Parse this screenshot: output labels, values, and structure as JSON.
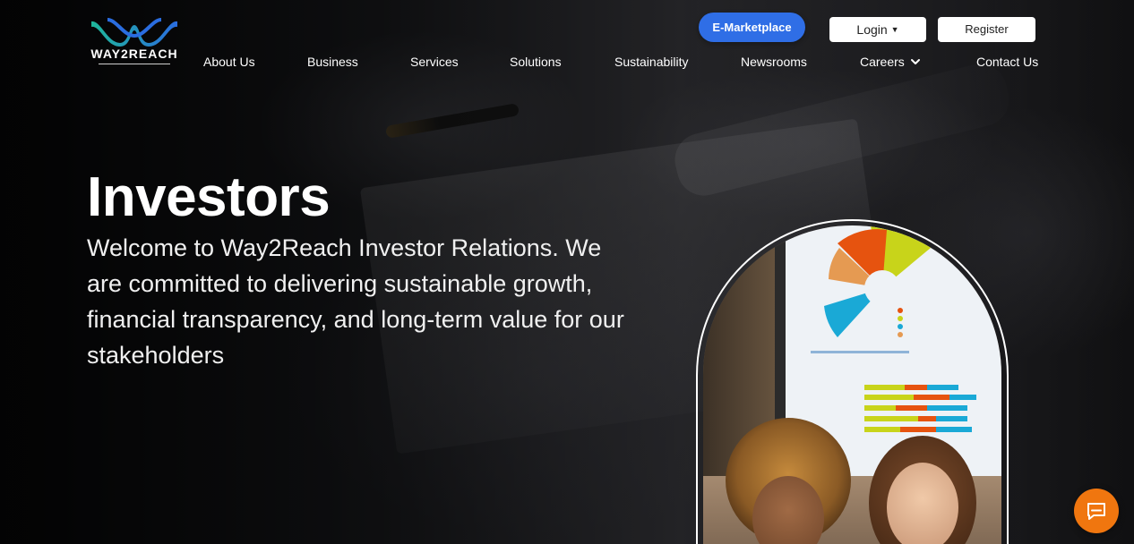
{
  "brand": {
    "logo_text": "way2reach"
  },
  "header": {
    "emarketplace_label": "E-Marketplace",
    "login_label": "Login",
    "register_label": "Register"
  },
  "nav": {
    "items": [
      {
        "label": "About Us"
      },
      {
        "label": "Business"
      },
      {
        "label": "Services"
      },
      {
        "label": "Solutions"
      },
      {
        "label": "Sustainability"
      },
      {
        "label": "Newsrooms"
      },
      {
        "label": "Careers"
      },
      {
        "label": "Contact Us"
      }
    ]
  },
  "hero": {
    "title": "Investors",
    "subtitle": "Welcome to Way2Reach Investor Relations. We are committed to delivering sustainable growth, financial transparency, and long-term value for our stakeholders"
  },
  "colors": {
    "accent_blue": "#2f6ee6",
    "chat_orange": "#f0760f",
    "logo_teal": "#1fb79a",
    "logo_blue": "#2a6de0"
  },
  "icons": {
    "chat": "chat-bubble-icon",
    "careers_dropdown": "chevron-down-icon",
    "login_dropdown": "caret-down-icon"
  }
}
